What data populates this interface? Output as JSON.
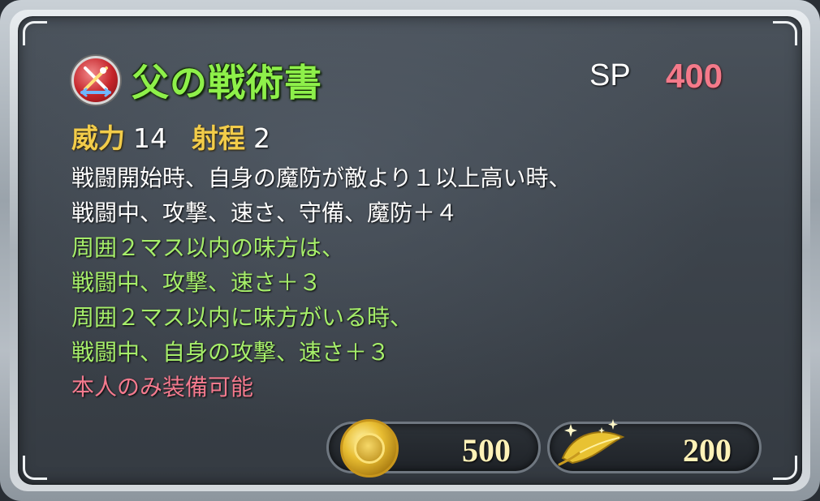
{
  "skill": {
    "name": "父の戦術書",
    "icon": "crossed-weapons-skill-icon"
  },
  "sp": {
    "label": "SP",
    "value": "400"
  },
  "stats": {
    "might_label": "威力",
    "might_value": "14",
    "range_label": "射程",
    "range_value": "2"
  },
  "description": {
    "lines": [
      {
        "text": "戦闘開始時、自身の魔防が敵より１以上高い時、",
        "color": "white"
      },
      {
        "text": "戦闘中、攻撃、速さ、守備、魔防＋４",
        "color": "white"
      },
      {
        "text": "周囲２マス以内の味方は、",
        "color": "green"
      },
      {
        "text": "戦闘中、攻撃、速さ＋３",
        "color": "green"
      },
      {
        "text": "周囲２マス以内に味方がいる時、",
        "color": "green"
      },
      {
        "text": "戦闘中、自身の攻撃、速さ＋３",
        "color": "green"
      },
      {
        "text": "本人のみ装備可能",
        "color": "pink"
      }
    ]
  },
  "costs": {
    "coin_icon": "gold-coin-icon",
    "coin_value": "500",
    "feather_icon": "golden-leaf-icon",
    "feather_value": "200"
  },
  "colors": {
    "title_green": "#8ef04a",
    "stat_gold": "#f2cc4a",
    "sp_pink": "#f47a8a",
    "desc_green": "#a6ee6a",
    "desc_pink": "#f47a8e"
  }
}
